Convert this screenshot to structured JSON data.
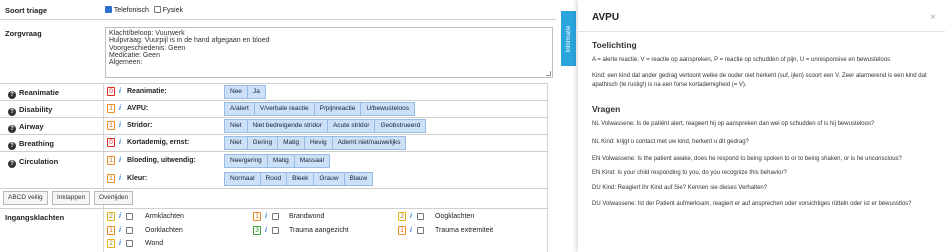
{
  "soort_triage": {
    "label": "Soort triage",
    "opt1": "Telefonisch",
    "opt2": "Fysiek"
  },
  "zorgvraag": {
    "label": "Zorgvraag",
    "lines": [
      "Klacht/beloop: Vuurwerk",
      "Hulpvraag: Vuurpijl is in de hand afgegaan en bloed",
      "Voorgeschiedenis: Geen",
      "Medicatie: Geen",
      "Algemeen:"
    ]
  },
  "rows": [
    {
      "name": "Reanimatie",
      "badge": "0",
      "sub": "Reanimatie:",
      "options": [
        "Nee",
        "Ja"
      ]
    },
    {
      "name": "Disability",
      "badge": "1",
      "sub": "AVPU:",
      "options": [
        "A/alert",
        "V/verbale reactie",
        "P/pijnreactie",
        "U/bewusteloos"
      ]
    },
    {
      "name": "Airway",
      "badge": "1",
      "sub": "Stridor:",
      "options": [
        "Niet",
        "Niet bedreigende stridor",
        "Acute stridor",
        "Geobstrueerd"
      ]
    },
    {
      "name": "Breathing",
      "badge": "0",
      "sub": "Kortademig, ernst:",
      "options": [
        "Niet",
        "Gering",
        "Matig",
        "Hevig",
        "Ademt niet/nauwelijks"
      ]
    },
    {
      "name": "Circulation",
      "badge": "1",
      "sub": "Bloeding, uitwendig:",
      "options": [
        "Nee/gering",
        "Matig",
        "Massaal"
      ]
    },
    {
      "name": "",
      "badge": "1",
      "sub": "Kleur:",
      "options": [
        "Normaal",
        "Rood",
        "Bleek",
        "Grauw",
        "Blauw"
      ]
    }
  ],
  "buttons": {
    "abcd": "ABCD veilig",
    "inklappen": "Inklappen",
    "overlijden": "Overlijden"
  },
  "ingangsklachten": {
    "label": "Ingangsklachten",
    "items": [
      {
        "badge": "2",
        "text": "Armklachten"
      },
      {
        "badge": "1",
        "text": "Brandwond"
      },
      {
        "badge": "2",
        "text": "Oogklachten"
      },
      {
        "badge": "1",
        "text": "Oorklachten"
      },
      {
        "badge": "3",
        "text": "Trauma aangezicht"
      },
      {
        "badge": "1",
        "text": "Trauma extremiteit"
      },
      {
        "badge": "2",
        "text": "Wond"
      }
    ]
  },
  "info_glyph": "i",
  "help_glyph": "?",
  "tab_label": "Informatie",
  "panel": {
    "title": "AVPU",
    "close": "×",
    "toelichting": "Toelichting",
    "t1": "A = alerte reactie, V = reactie op aanspreken, P = reactie op schudden of pijn, U = unresponsive en bewusteloos",
    "t2": "Kind: een kind dat ander gedrag vertoont welke de ouder niet herkent (suf, ijlen) scoort een V. Zeer alarmerend is een kind dat apathisch (te rustig!) is na een forse kortademigheid (= V).",
    "vragen": "Vragen",
    "q": [
      "NL Volwassene: Is de patiënt alert, reageert hij op aanspreken dan wel op schudden of is hij bewusteloos?",
      "NL Kind: krijgt u contact met uw kind, herkent u dit gedrag?",
      "EN Volwassene: Is the patient awake, does he respond to being spoken to or to being shaken, or is he unconscious?",
      "EN Kind: Is your child responding to you, do you recognize this behavior?",
      "DU Kind: Reagiert ihr Kind auf Sie? Kennen sie dieses Verhalten?",
      "DU Volwassene: Ist der Patient aufmerksam, reagiert er auf ansprechen oder vorsichtiges rütteln oder ist er bewusstlos?"
    ]
  },
  "colors": {
    "accent": "#2aa4dc",
    "seg": "#cce1f7",
    "red": "#e0291f",
    "orange": "#f08a24",
    "yellow": "#e7b416",
    "green": "#3fa63a"
  }
}
